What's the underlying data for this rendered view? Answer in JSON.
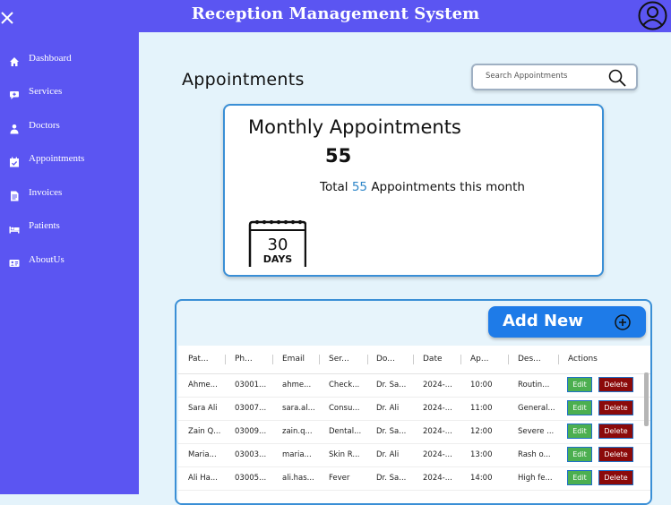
{
  "header": {
    "title": "Reception Management System"
  },
  "sidebar": {
    "items": [
      {
        "label": "Dashboard",
        "icon": "home-icon"
      },
      {
        "label": "Services",
        "icon": "services-icon"
      },
      {
        "label": "Doctors",
        "icon": "doctor-icon"
      },
      {
        "label": "Appointments",
        "icon": "calendar-check-icon"
      },
      {
        "label": "Invoices",
        "icon": "invoice-icon"
      },
      {
        "label": "Patients",
        "icon": "bed-icon"
      },
      {
        "label": "AboutUs",
        "icon": "id-card-icon"
      }
    ]
  },
  "main": {
    "title": "Appointments",
    "search": {
      "placeholder": "Search Appointments"
    },
    "stats": {
      "title": "Monthly Appointments",
      "count": "55",
      "line_prefix": "Total",
      "line_count": "55",
      "line_suffix": "Appointments  this month",
      "calendar_number": "30",
      "calendar_label": "DAYS"
    },
    "add_button_label": "Add New",
    "table": {
      "columns": [
        "Pat...",
        "Ph...",
        "Email",
        "Ser...",
        "Do...",
        "Date",
        "Ap...",
        "Des...",
        "Actions"
      ],
      "rows": [
        [
          "Ahme...",
          "03001...",
          "ahme...",
          "Check...",
          "Dr. Sa...",
          "2024-...",
          "10:00",
          "Routin..."
        ],
        [
          "Sara Ali",
          "03007...",
          "sara.al...",
          "Consu...",
          "Dr. Ali",
          "2024-...",
          "11:00",
          "General..."
        ],
        [
          "Zain Q...",
          "03009...",
          "zain.q...",
          "Dental...",
          "Dr. Sa...",
          "2024-...",
          "12:00",
          "Severe ..."
        ],
        [
          "Maria...",
          "03003...",
          "maria...",
          "Skin R...",
          "Dr. Ali",
          "2024-...",
          "13:00",
          "Rash o..."
        ],
        [
          "Ali Ha...",
          "03005...",
          "ali.has...",
          "Fever",
          "Dr. Sa...",
          "2024-...",
          "14:00",
          "High fe..."
        ]
      ],
      "edit_label": "Edit",
      "delete_label": "Delete"
    }
  },
  "colors": {
    "sidebar": "#5b55f2",
    "background": "#e4f3fb",
    "accent": "#1e7be8",
    "edit": "#4caf50",
    "delete": "#8b0a0a",
    "highlight": "#2e86c8"
  }
}
